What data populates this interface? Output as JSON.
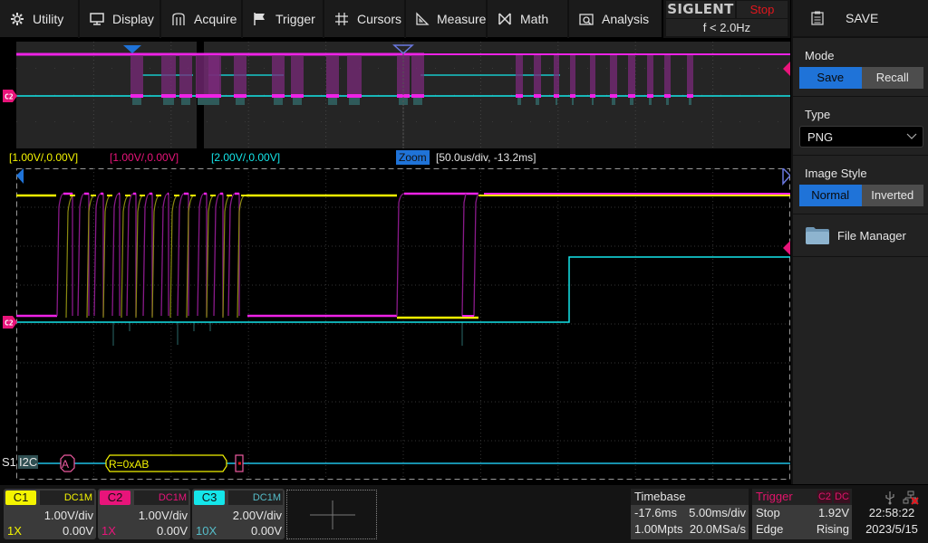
{
  "menu": {
    "items": [
      {
        "label": "Utility",
        "icon": "gear-icon"
      },
      {
        "label": "Display",
        "icon": "monitor-icon"
      },
      {
        "label": "Acquire",
        "icon": "acquire-icon"
      },
      {
        "label": "Trigger",
        "icon": "flag-icon"
      },
      {
        "label": "Cursors",
        "icon": "cursors-grid-icon"
      },
      {
        "label": "Measure",
        "icon": "ruler-triangle-icon"
      },
      {
        "label": "Math",
        "icon": "math-icon"
      },
      {
        "label": "Analysis",
        "icon": "analysis-icon"
      }
    ]
  },
  "brand": {
    "logo": "SIGLENT",
    "run_state": "Stop",
    "trigger_freq": "f < 2.0Hz"
  },
  "side_panel": {
    "title": "SAVE",
    "mode": {
      "label": "Mode",
      "options": [
        "Save",
        "Recall"
      ],
      "selected": "Save"
    },
    "type": {
      "label": "Type",
      "value": "PNG"
    },
    "image_style": {
      "label": "Image Style",
      "options": [
        "Normal",
        "Inverted"
      ],
      "selected": "Normal"
    },
    "file_manager": {
      "label": "File Manager"
    }
  },
  "channel_labels": {
    "c1": "[1.00V/,0.00V]",
    "c2": "[1.00V/,0.00V]",
    "c3": "[2.00V/,0.00V]",
    "zoom_tag": "Zoom",
    "zoom_info": "[50.0us/div, -13.2ms]"
  },
  "markers": {
    "c2_level": "C2"
  },
  "decode": {
    "bus": "S1",
    "protocol": "I2C",
    "frames": [
      {
        "type": "address",
        "text": "A"
      },
      {
        "type": "data",
        "text": "R=0xAB"
      },
      {
        "type": "nack",
        "text": ""
      }
    ]
  },
  "channels": [
    {
      "name": "C1",
      "coupling": "DC1M",
      "scale": "1.00V/div",
      "probe": "1X",
      "offset": "0.00V",
      "color": "#f4f400"
    },
    {
      "name": "C2",
      "coupling": "DC1M",
      "scale": "1.00V/div",
      "probe": "1X",
      "offset": "0.00V",
      "color": "#e8147a"
    },
    {
      "name": "C3",
      "coupling": "DC1M",
      "scale": "2.00V/div",
      "probe": "10X",
      "offset": "0.00V",
      "color": "#14e6ea"
    }
  ],
  "timebase": {
    "label": "Timebase",
    "delay": "-17.6ms",
    "scale": "5.00ms/div",
    "memory": "1.00Mpts",
    "sample_rate": "20.0MSa/s"
  },
  "trigger": {
    "label": "Trigger",
    "source": "C2",
    "coupling": "DC",
    "state": "Stop",
    "level": "1.92V",
    "type": "Edge",
    "slope": "Rising",
    "color": "#e2146b"
  },
  "system": {
    "time": "22:58:22",
    "date": "2023/5/15"
  },
  "colors": {
    "c1": "#f4f400",
    "c2": "#ee22e6",
    "c3": "#14e6ea",
    "accent": "#1f73d8"
  }
}
